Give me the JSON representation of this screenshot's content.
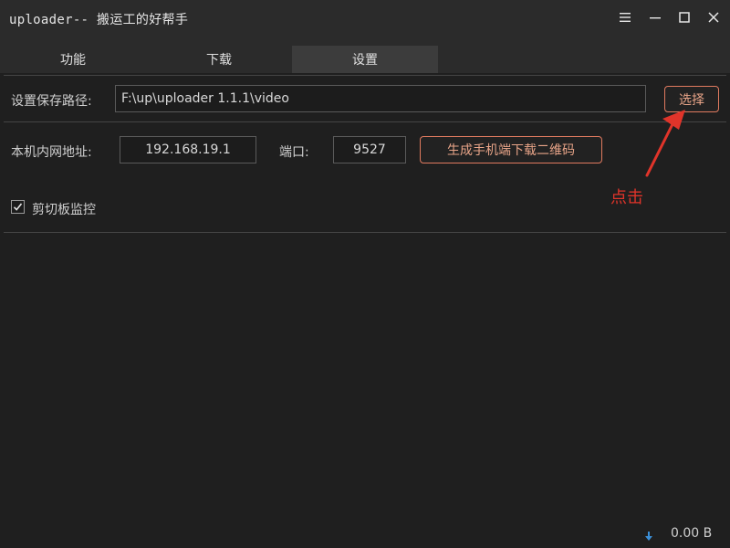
{
  "window": {
    "title": "uploader-- 搬运工的好帮手"
  },
  "tabs": [
    {
      "label": "功能",
      "active": false
    },
    {
      "label": "下载",
      "active": false
    },
    {
      "label": "设置",
      "active": true
    }
  ],
  "settings": {
    "save_path_label": "设置保存路径:",
    "save_path_value": "F:\\up\\uploader 1.1.1\\video",
    "choose_button": "选择",
    "lan_address_label": "本机内网地址:",
    "lan_address_value": "192.168.19.1",
    "port_label": "端口:",
    "port_value": "9527",
    "qr_button": "生成手机端下载二维码",
    "clipboard_label": "剪切板监控",
    "clipboard_checked": true
  },
  "annotation": {
    "text": "点击",
    "color": "#e0342a"
  },
  "status": {
    "icon": "download-arrow-icon",
    "text": "0.00 B"
  },
  "colors": {
    "accent": "#e07a5f",
    "background": "#1f1f1f",
    "titlebar": "#2b2b2b"
  }
}
